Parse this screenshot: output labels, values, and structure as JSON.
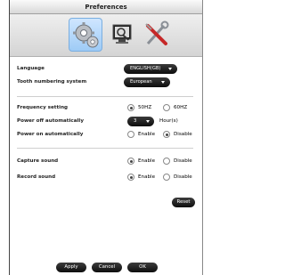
{
  "window": {
    "title": "Preferences"
  },
  "toolbar": {
    "icons": [
      "gear-icon",
      "monitor-icon",
      "tools-icon"
    ],
    "active_index": 0
  },
  "settings": {
    "language": {
      "label": "Language",
      "value": "ENGLISH(GB)"
    },
    "tooth_numbering": {
      "label": "Tooth numbering system",
      "value": "European"
    },
    "frequency": {
      "label": "Frequency setting",
      "options": [
        "50HZ",
        "60HZ"
      ],
      "selected": "50HZ"
    },
    "power_off": {
      "label": "Power off automatically",
      "value": "3",
      "unit": "Hour(s)"
    },
    "power_on": {
      "label": "Power on automatically",
      "options": [
        "Enable",
        "Disable"
      ],
      "selected": "Disable"
    },
    "capture_sound": {
      "label": "Capture sound",
      "options": [
        "Enable",
        "Disable"
      ],
      "selected": "Enable"
    },
    "record_sound": {
      "label": "Record sound",
      "options": [
        "Enable",
        "Disable"
      ],
      "selected": "Enable"
    }
  },
  "buttons": {
    "reset": "Reset",
    "apply": "Apply",
    "cancel": "Cancel",
    "ok": "OK"
  }
}
